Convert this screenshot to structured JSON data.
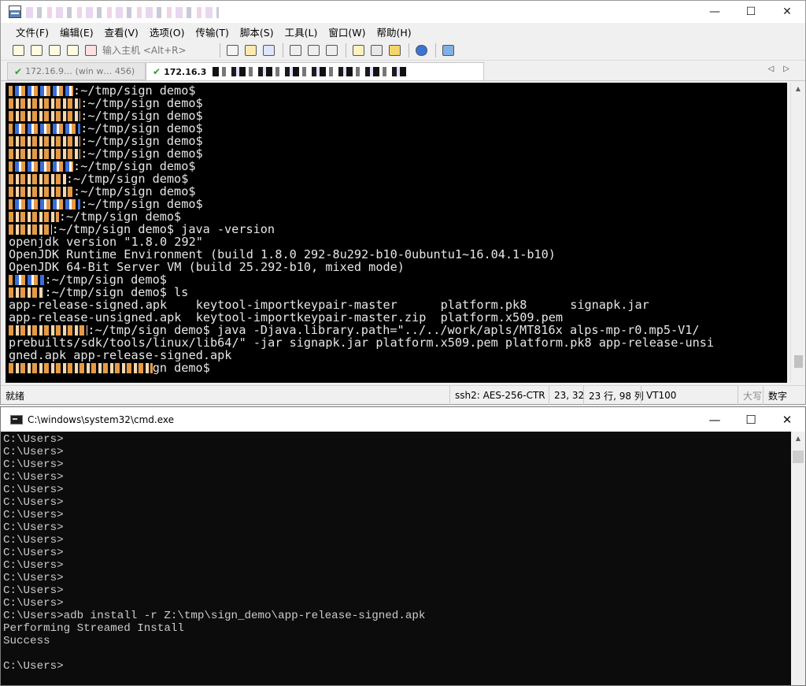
{
  "crt": {
    "window_controls": {
      "minimize": "—",
      "maximize": "☐",
      "close": "✕"
    },
    "menu": [
      "文件(F)",
      "编辑(E)",
      "查看(V)",
      "选项(O)",
      "传输(T)",
      "脚本(S)",
      "工具(L)",
      "窗口(W)",
      "帮助(H)"
    ],
    "toolbar": {
      "host_placeholder": "输入主机 <Alt+R>",
      "icons_left": [
        "connect-icon",
        "quick-connect-icon",
        "connect-tab-icon",
        "reconnect-icon",
        "disconnect-icon"
      ],
      "icons_mid": [
        "copy-icon",
        "paste-icon",
        "find-icon",
        "print-icon",
        "print-setup-icon",
        "print-screen-icon"
      ],
      "icons_right": [
        "session-options-icon",
        "global-options-icon",
        "key-icon",
        "help-icon",
        "sftp-icon"
      ]
    },
    "tabs": [
      {
        "label": "172.16.9… (win w… 456)",
        "active": false
      },
      {
        "label": "172.16.3",
        "active": true
      }
    ],
    "terminal_lines": [
      {
        "redact": "h@ubunt",
        "text": ":~/tmp/sign_demo$"
      },
      {
        "redact": "h@ubuntu",
        "text": ":~/tmp/sign_demo$"
      },
      {
        "redact": "h@ubuntu",
        "text": ":~/tmp/sign_demo$"
      },
      {
        "redact": "h@ubuntu",
        "text": ":~/tmp/sign_demo$"
      },
      {
        "redact": "h@ubuntu",
        "text": ":~/tmp/sign_demo$"
      },
      {
        "redact": "h@ubuntu",
        "text": ":~/tmp/sign_demo$"
      },
      {
        "redact": "@ubuntu",
        "text": ":~/tmp/sign_demo$"
      },
      {
        "redact": "ubuntu",
        "text": ":~/tmp/sign_demo$"
      },
      {
        "redact": "ubunt-y",
        "text": ":~/tmp/sign_demo$"
      },
      {
        "redact": "@ubunt-y",
        "text": ":~/tmp/sign_demo$"
      },
      {
        "redact": "h@ubu",
        "text": ":~/tmp/sign_demo$"
      },
      {
        "redact": "tu-y",
        "text": ":~/tmp/sign_demo$ java -version"
      },
      {
        "redact": "",
        "text": "openjdk version \"1.8.0_292\""
      },
      {
        "redact": "",
        "text": "OpenJDK Runtime Environment (build 1.8.0_292-8u292-b10-0ubuntu1~16.04.1-b10)"
      },
      {
        "redact": "",
        "text": "OpenJDK 64-Bit Server VM (build 25.292-b10, mixed mode)"
      },
      {
        "redact": "-yf",
        "text": ":~/tmp/sign_demo$"
      },
      {
        "redact": "-yf",
        "text": ":~/tmp/sign_demo$ ls"
      },
      {
        "redact": "",
        "text": "app-release-signed.apk    keytool-importkeypair-master      platform.pk8      signapk.jar"
      },
      {
        "redact": "",
        "text": "app-release-unsigned.apk  keytool-importkeypair-master.zip  platform.x509.pem"
      },
      {
        "redact": "ubuntu-yf",
        "text": ":~/tmp/sign_demo$ java -Djava.library.path=\"../../work/apls/MT816x_alps-mp-r0.mp5-V1/"
      },
      {
        "redact": "",
        "text": "prebuilts/sdk/tools/linux/lib64/\" -jar signapk.jar platform.x509.pem platform.pk8 app-release-unsi"
      },
      {
        "redact": "",
        "text": "gned.apk app-release-signed.apk"
      },
      {
        "redact": "ubuntu-yf:~/tmp/si",
        "text": "gn_demo$"
      }
    ],
    "status": {
      "ready": "就绪",
      "cipher": "ssh2: AES-256-CTR",
      "cursor": "23,  32",
      "rows_cols": "23 行, 98 列",
      "emulation": "VT100",
      "caps": "大写",
      "num": "数字"
    }
  },
  "cmd": {
    "title": "C:\\windows\\system32\\cmd.exe",
    "window_controls": {
      "minimize": "—",
      "maximize": "☐",
      "close": "✕"
    },
    "lines": [
      "C:\\Users>",
      "C:\\Users>",
      "C:\\Users>",
      "C:\\Users>",
      "C:\\Users>",
      "C:\\Users>",
      "C:\\Users>",
      "C:\\Users>",
      "C:\\Users>",
      "C:\\Users>",
      "C:\\Users>",
      "C:\\Users>",
      "C:\\Users>",
      "C:\\Users>",
      "C:\\Users>adb install -r Z:\\tmp\\sign_demo\\app-release-signed.apk",
      "Performing Streamed Install",
      "Success",
      "",
      "C:\\Users>"
    ]
  }
}
